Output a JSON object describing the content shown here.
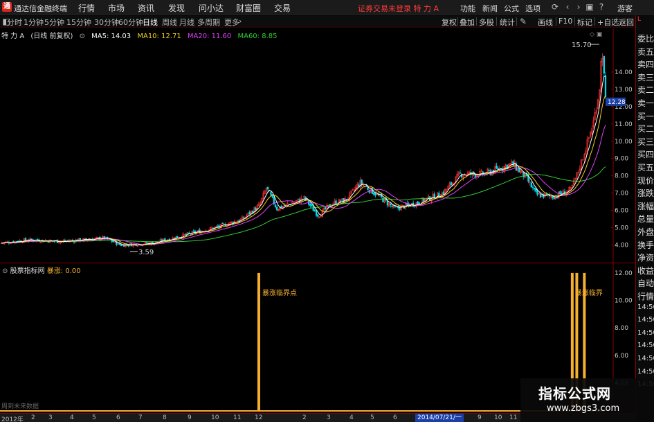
{
  "app": {
    "logo_glyph": "通",
    "title": "通达信金融终端"
  },
  "menu": [
    "行情",
    "市场",
    "资讯",
    "发现",
    "问小达",
    "财富圈",
    "交易"
  ],
  "login_status": "证券交易未登录  特 力 A",
  "right_menu": [
    "功能",
    "新闻",
    "公式",
    "选项"
  ],
  "guest_label": "游客",
  "periods": [
    {
      "label": "分时",
      "active": false
    },
    {
      "label": "1分钟",
      "active": false
    },
    {
      "label": "5分钟",
      "active": false
    },
    {
      "label": "15分钟",
      "active": false
    },
    {
      "label": "30分钟",
      "active": false
    },
    {
      "label": "60分钟",
      "active": false
    },
    {
      "label": "日线",
      "active": true
    },
    {
      "label": "周线",
      "active": false
    },
    {
      "label": "月线",
      "active": false
    },
    {
      "label": "多周期",
      "active": false
    },
    {
      "label": "更多",
      "active": false
    }
  ],
  "right_tools": [
    "复权",
    "叠加",
    "多股",
    "统计",
    "画线",
    "F10",
    "标记",
    "+自选",
    "返回"
  ],
  "main_legend": {
    "stock": "特 力 A",
    "adjust": "(日线 前复权)",
    "ma": [
      {
        "label": "MA5: 14.03",
        "color": "#ffffff"
      },
      {
        "label": "MA10: 12.71",
        "color": "#f5d020"
      },
      {
        "label": "MA20: 11.60",
        "color": "#e040fb"
      },
      {
        "label": "MA60: 8.85",
        "color": "#33cc33"
      }
    ]
  },
  "main_axis": {
    "ticks": [
      "14.00",
      "13.00",
      "12.00",
      "11.00",
      "10.00",
      "9.00",
      "8.00",
      "7.00",
      "6.00",
      "5.00",
      "4.00"
    ],
    "current_price": "12.28",
    "high_label": "15.70",
    "low_label": "3.59"
  },
  "sub_legend": {
    "name": "股票指标网",
    "series": "暴涨: 0.00"
  },
  "sub_axis": {
    "ticks": [
      "12.00",
      "10.00",
      "8.00",
      "6.00",
      "4.00"
    ]
  },
  "sub_annotations": {
    "left": "暴涨临界点",
    "right": "暴涨临界"
  },
  "sub_footer": "周到未来数据",
  "time_axis": {
    "labels": [
      "2012年",
      "2",
      "3",
      "4",
      "5",
      "6",
      "7",
      "8",
      "9",
      "10",
      "11",
      "12",
      "2",
      "3",
      "4",
      "5",
      "6",
      "7",
      "8",
      "9",
      "10",
      "11"
    ],
    "cursor_date": "2014/07/21/一"
  },
  "sidebar": [
    "委比",
    "卖五",
    "卖四",
    "卖三",
    "卖二",
    "卖一",
    "买一",
    "买二",
    "买三",
    "买四",
    "买五",
    "现价",
    "涨跌",
    "涨幅",
    "总量",
    "外盘",
    "换手",
    "净资",
    "收益",
    "自动",
    "行情",
    "14:50",
    "14:50",
    "14:50",
    "14:50",
    "14:50",
    "14:50",
    "14:50"
  ],
  "watermark": {
    "title": "指标公式网",
    "url": "www.zbgs3.com"
  },
  "colors": {
    "up": "#ff3030",
    "down": "#00ddee",
    "accent": "#f5b030",
    "axis": "#8a0000"
  },
  "chart_data": {
    "type": "candlestick",
    "title": "",
    "y_range": [
      3.3,
      16.2
    ],
    "candles": [],
    "ma5": [],
    "ma10": [],
    "ma20": [],
    "ma60": [],
    "indicator": {
      "name": "暴涨",
      "y_range": [
        2,
        12.5
      ],
      "spikes": [
        {
          "bar_index": 170,
          "value": 12.0
        },
        {
          "bar_index": 377,
          "value": 12.0
        },
        {
          "bar_index": 380,
          "value": 12.0
        },
        {
          "bar_index": 385,
          "value": 12.0
        }
      ]
    }
  }
}
